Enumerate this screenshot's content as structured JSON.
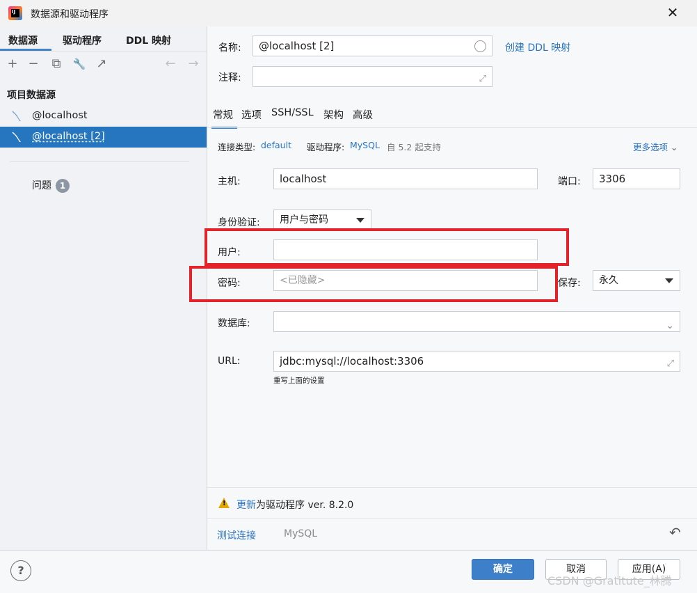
{
  "window": {
    "title": "数据源和驱动程序",
    "app_icon_text": "IJ",
    "close_glyph": "✕"
  },
  "left": {
    "tabs": [
      {
        "label": "数据源",
        "active": true
      },
      {
        "label": "驱动程序",
        "active": false
      },
      {
        "label": "DDL 映射",
        "active": false
      }
    ],
    "toolbar": {
      "add": "+",
      "remove": "−",
      "copy": "⧉",
      "settings": "🔧",
      "export": "↗",
      "back": "←",
      "forward": "→"
    },
    "section_title": "项目数据源",
    "items": [
      {
        "label": "@localhost",
        "selected": false
      },
      {
        "label": "@localhost [2]",
        "selected": true
      }
    ],
    "problems": {
      "label": "问题",
      "count": "1"
    }
  },
  "form": {
    "name_label": "名称:",
    "name_value": "@localhost [2]",
    "create_ddl_link": "创建 DDL 映射",
    "comment_label": "注释:",
    "comment_value": "",
    "tabs": [
      "常规",
      "选项",
      "SSH/SSL",
      "架构",
      "高级"
    ],
    "active_tab": "常规",
    "conn_type_label": "连接类型:",
    "conn_type_value": "default",
    "driver_label": "驱动程序:",
    "driver_value": "MySQL",
    "driver_support": "自 5.2 起支持",
    "more_options": "更多选项",
    "host_label": "主机:",
    "host_value": "localhost",
    "port_label": "端口:",
    "port_value": "3306",
    "auth_label": "身份验证:",
    "auth_value": "用户与密码",
    "user_label": "用户:",
    "user_value": "",
    "password_label": "密码:",
    "password_placeholder": "<已隐藏>",
    "save_label": "保存:",
    "save_value": "永久",
    "database_label": "数据库:",
    "database_value": "",
    "url_label": "URL:",
    "url_value": "jdbc:mysql://localhost:3306",
    "url_hint": "重写上面的设置",
    "update_link": "更新",
    "update_text": "为驱动程序 ver. 8.2.0",
    "test_connection": "测试连接",
    "driver_footer": "MySQL",
    "revert_glyph": "↶"
  },
  "footer": {
    "help": "?",
    "ok": "确定",
    "cancel": "取消",
    "apply": "应用(A)",
    "watermark": "CSDN @Gratitute_林腾"
  },
  "colors": {
    "accent": "#2675bf",
    "link": "#2a73c4",
    "highlight_box": "#e3232a",
    "warning": "#e0a800"
  }
}
